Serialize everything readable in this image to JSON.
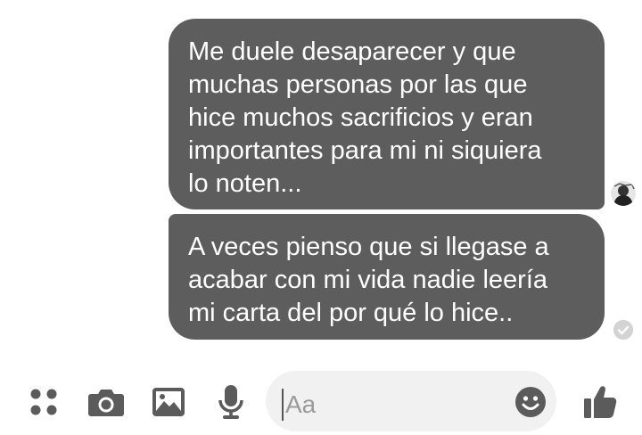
{
  "messages": [
    {
      "text": "Me duele desaparecer y que\nmuchas personas por las que\nhice muchos sacrificios y eran\nimportantes para mi ni siquiera\nlo noten..."
    },
    {
      "text": "A veces pienso que si llegase a\nacabar con mi vida nadie leería\nmi carta del por qué lo hice.."
    }
  ],
  "composer": {
    "placeholder": "Aa"
  },
  "icons": {
    "more": "apps-icon",
    "camera": "camera-icon",
    "photo": "image-icon",
    "mic": "microphone-icon",
    "emoji": "emoji-icon",
    "like": "thumbs-up-icon",
    "seen": "check-circle-icon",
    "avatar": "avatar"
  },
  "colors": {
    "bubble": "#5d5d5d",
    "icon": "#5b5b5b",
    "input_bg": "#f1f1f1"
  }
}
